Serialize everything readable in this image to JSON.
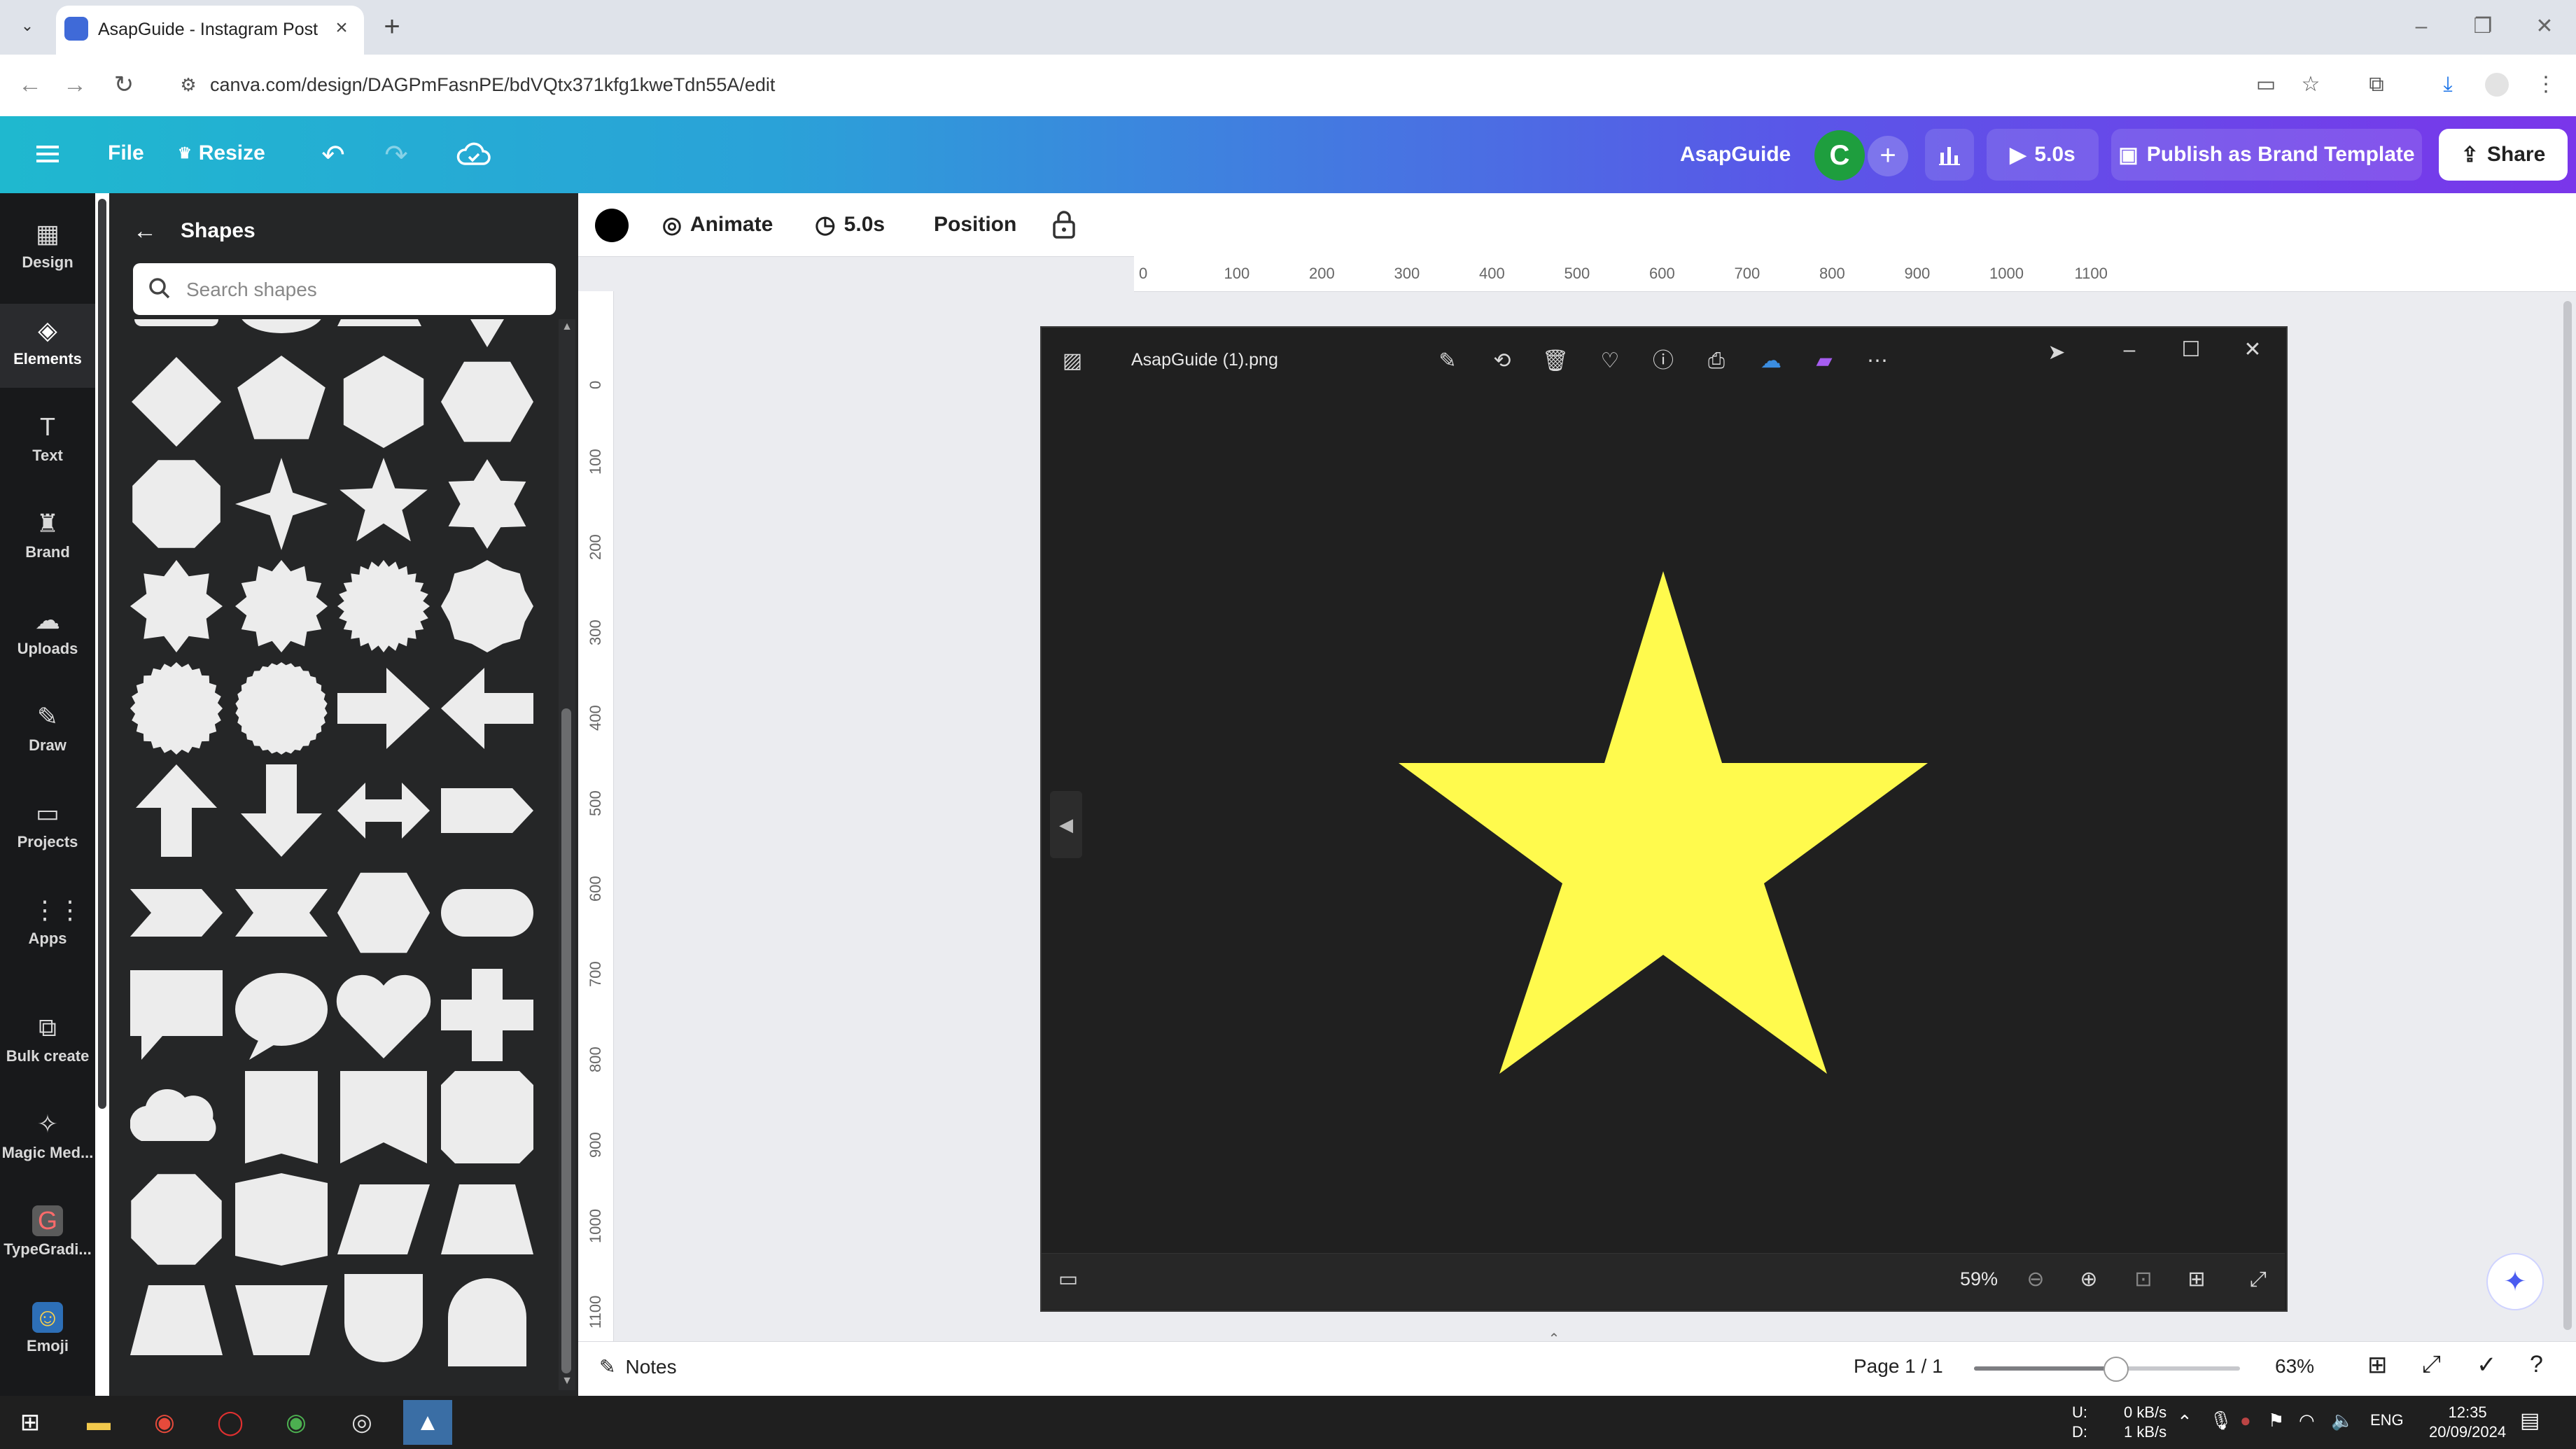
{
  "browser": {
    "tab_title": "AsapGuide - Instagram Post",
    "url": "canva.com/design/DAGPmFasnPE/bdVQtx371kfg1kweTdn55A/edit"
  },
  "topbar": {
    "menu_label": "File",
    "resize_label": "Resize",
    "team_name": "AsapGuide",
    "avatar_letter": "C",
    "play_duration": "5.0s",
    "publish_label": "Publish as Brand Template",
    "share_label": "Share"
  },
  "rail": {
    "items": [
      {
        "label": "Design",
        "icon": "layout-icon"
      },
      {
        "label": "Elements",
        "icon": "elements-icon"
      },
      {
        "label": "Text",
        "icon": "text-icon"
      },
      {
        "label": "Brand",
        "icon": "brand-icon"
      },
      {
        "label": "Uploads",
        "icon": "upload-icon"
      },
      {
        "label": "Draw",
        "icon": "pen-icon"
      },
      {
        "label": "Projects",
        "icon": "folder-icon"
      },
      {
        "label": "Apps",
        "icon": "apps-grid-icon"
      },
      {
        "label": "Bulk create",
        "icon": "bulk-icon"
      },
      {
        "label": "Magic Med...",
        "icon": "magic-media-icon"
      },
      {
        "label": "TypeGradi...",
        "icon": "typegradient-icon"
      },
      {
        "label": "Emoji",
        "icon": "emoji-icon"
      }
    ]
  },
  "panel": {
    "title": "Shapes",
    "search_placeholder": "Search shapes"
  },
  "editor_toolbar": {
    "animate_label": "Animate",
    "duration_label": "5.0s",
    "position_label": "Position",
    "color": "#000000"
  },
  "ruler": {
    "h_ticks": [
      "0",
      "100",
      "200",
      "300",
      "400",
      "500",
      "600",
      "700",
      "800",
      "900",
      "1000",
      "1100"
    ],
    "v_ticks": [
      "0",
      "100",
      "200",
      "300",
      "400",
      "500",
      "600",
      "700",
      "800",
      "900",
      "1000",
      "1100"
    ]
  },
  "viewer": {
    "file_name": "AsapGuide (1).png",
    "zoom": "59%",
    "star_color": "#fffa4d"
  },
  "status": {
    "notes_label": "Notes",
    "page_label": "Page 1 / 1",
    "zoom_label": "63%",
    "zoom_fraction": 0.63
  },
  "taskbar": {
    "net_up": "0 kB/s",
    "net_down": "1 kB/s",
    "net_u_label": "U:",
    "net_d_label": "D:",
    "lang": "ENG",
    "time": "12:35",
    "date": "20/09/2024"
  }
}
